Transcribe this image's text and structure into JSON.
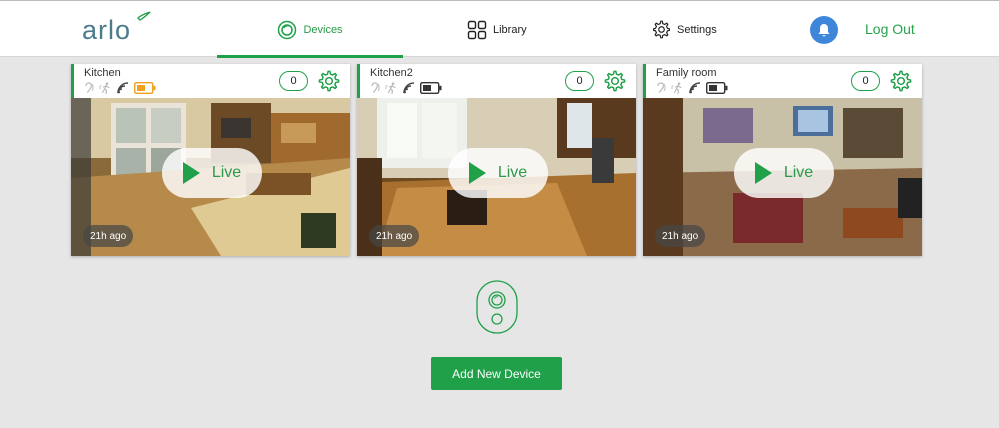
{
  "header": {
    "logo": "arlo",
    "nav": [
      {
        "label": "Devices",
        "icon": "devices-icon"
      },
      {
        "label": "Library",
        "icon": "library-grid-icon"
      },
      {
        "label": "Settings",
        "icon": "gear-icon"
      }
    ],
    "notifications_icon": "bell-icon",
    "logout_label": "Log Out"
  },
  "cameras": [
    {
      "name": "Kitchen",
      "count": "0",
      "last_seen": "21h ago",
      "live_label": "Live",
      "battery": "low"
    },
    {
      "name": "Kitchen2",
      "count": "0",
      "last_seen": "21h ago",
      "live_label": "Live",
      "battery": "normal"
    },
    {
      "name": "Family room",
      "count": "0",
      "last_seen": "21h ago",
      "live_label": "Live",
      "battery": "normal"
    }
  ],
  "add_device_label": "Add New Device",
  "colors": {
    "accent": "#1fa049",
    "battery_low": "#f0a020",
    "bell": "#3d86d9",
    "logo": "#4a7c8c"
  }
}
